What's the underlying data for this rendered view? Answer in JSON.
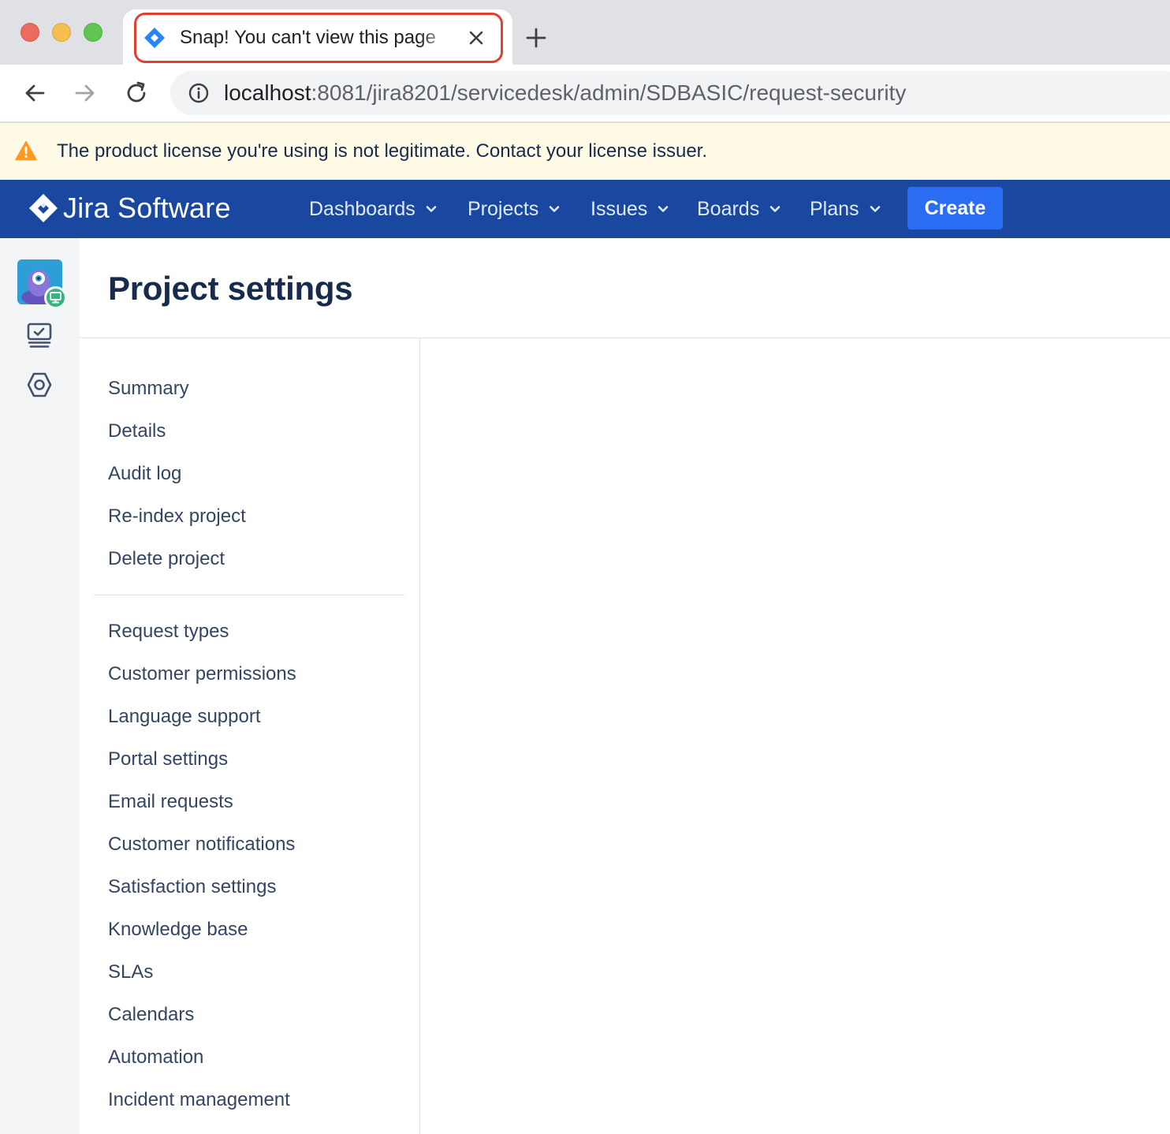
{
  "browser": {
    "tab_title": "Snap! You can't view this page",
    "url_host": "localhost",
    "url_path": ":8081/jira8201/servicedesk/admin/SDBASIC/request-security"
  },
  "banner": {
    "message": "The product license you're using is not legitimate. Contact your license issuer.",
    "icon": "warning-icon",
    "color": "#fffae6"
  },
  "header": {
    "brand": "Jira Software",
    "nav": [
      {
        "label": "Dashboards"
      },
      {
        "label": "Projects"
      },
      {
        "label": "Issues"
      },
      {
        "label": "Boards"
      },
      {
        "label": "Plans"
      }
    ],
    "create_label": "Create",
    "colors": {
      "header": "#1a47a0",
      "create": "#2a6cf2"
    }
  },
  "rail": {
    "icons": [
      "project-avatar",
      "queues-icon",
      "settings-icon"
    ]
  },
  "page": {
    "title": "Project settings"
  },
  "settings_nav": {
    "group1": [
      {
        "label": "Summary"
      },
      {
        "label": "Details"
      },
      {
        "label": "Audit log"
      },
      {
        "label": "Re-index project"
      },
      {
        "label": "Delete project"
      }
    ],
    "group2": [
      {
        "label": "Request types"
      },
      {
        "label": "Customer permissions"
      },
      {
        "label": "Language support"
      },
      {
        "label": "Portal settings"
      },
      {
        "label": "Email requests"
      },
      {
        "label": "Customer notifications"
      },
      {
        "label": "Satisfaction settings"
      },
      {
        "label": "Knowledge base"
      },
      {
        "label": "SLAs"
      },
      {
        "label": "Calendars"
      },
      {
        "label": "Automation"
      },
      {
        "label": "Incident management"
      }
    ]
  }
}
